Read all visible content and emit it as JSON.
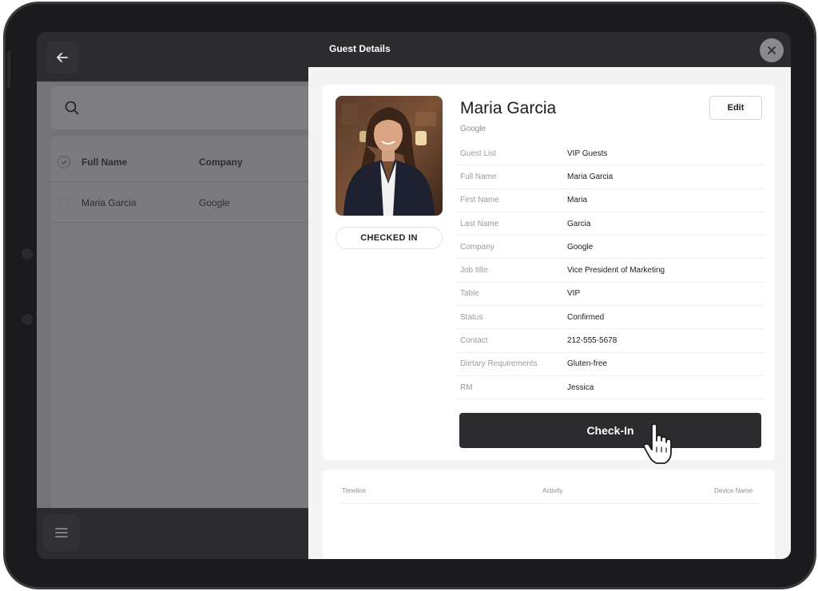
{
  "window": {
    "title": "Guest Details"
  },
  "list": {
    "columns": [
      "Full Name",
      "Company"
    ],
    "rows": [
      {
        "full_name": "Maria Garcia",
        "company": "Google"
      }
    ]
  },
  "guest": {
    "name": "Maria Garcia",
    "company": "Google",
    "status_pill": "CHECKED IN",
    "edit_label": "Edit",
    "fields": [
      {
        "label": "Guest List",
        "value": "VIP Guests"
      },
      {
        "label": "Full Name",
        "value": "Maria Garcia"
      },
      {
        "label": "First Name",
        "value": "Maria"
      },
      {
        "label": "Last Name",
        "value": "Garcia"
      },
      {
        "label": "Company",
        "value": "Google"
      },
      {
        "label": "Job title",
        "value": "Vice President of Marketing"
      },
      {
        "label": "Table",
        "value": "VIP"
      },
      {
        "label": "Status",
        "value": "Confirmed"
      },
      {
        "label": "Contact",
        "value": "212-555-5678"
      },
      {
        "label": "Dietary Requirements",
        "value": "Gluten-free"
      },
      {
        "label": "RM",
        "value": "Jessica"
      }
    ],
    "checkin_label": "Check-In"
  },
  "timeline": {
    "headers": [
      "Timeline",
      "Activity",
      "Device Name"
    ]
  },
  "icons": {
    "back": "arrow-left-icon",
    "close": "close-icon",
    "search": "search-icon",
    "menu": "hamburger-menu-icon",
    "cursor": "hand-pointer-icon"
  },
  "colors": {
    "dark_bg": "#2c2c2e",
    "button_dark": "#2c2c2e",
    "panel_bg": "#f4f4f5"
  }
}
